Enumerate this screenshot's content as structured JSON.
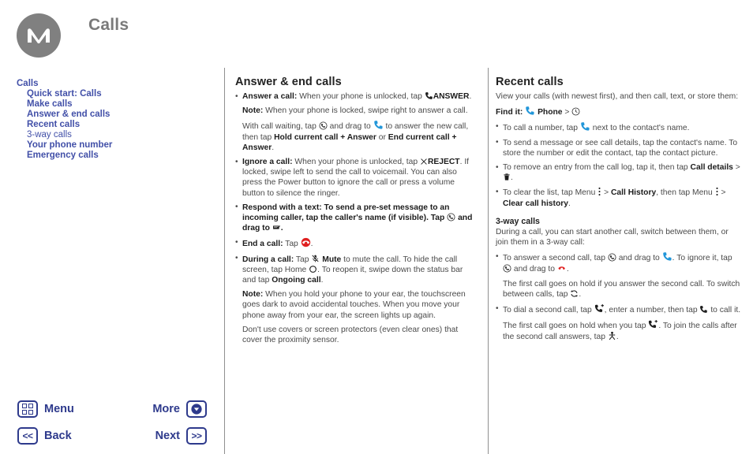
{
  "header": {
    "title": "Calls",
    "logo_icon": "motorola-logo"
  },
  "sidebar": {
    "items": [
      {
        "label": "Calls",
        "level": "root",
        "weight": "bold"
      },
      {
        "label": "Quick start: Calls",
        "level": "sub",
        "weight": "bold"
      },
      {
        "label": "Make calls",
        "level": "sub",
        "weight": "bold"
      },
      {
        "label": "Answer & end calls",
        "level": "sub",
        "weight": "bold"
      },
      {
        "label": "Recent calls",
        "level": "sub",
        "weight": "bold"
      },
      {
        "label": "3-way calls",
        "level": "sub",
        "weight": "light"
      },
      {
        "label": "Your phone number",
        "level": "sub",
        "weight": "bold"
      },
      {
        "label": "Emergency calls",
        "level": "sub",
        "weight": "bold"
      }
    ]
  },
  "middle": {
    "heading": "Answer & end calls",
    "answer_call_label": "Answer a call:",
    "answer_call_text": " When your phone is unlocked, tap",
    "answer_call_action": "ANSWER",
    "answer_call_end": ".",
    "note1_label": "Note:",
    "note1_text": " When your phone is locked, swipe right to answer a call.",
    "call_waiting_pre": "With call waiting, tap",
    "call_waiting_mid": "and drag to",
    "call_waiting_post": "to answer the new call, then tap",
    "call_waiting_opt1": "Hold current call + Answer",
    "call_waiting_or": " or ",
    "call_waiting_opt2": "End current call + Answer",
    "call_waiting_end": ".",
    "ignore_label": "Ignore a call:",
    "ignore_text": " When your phone is unlocked, tap",
    "ignore_action": "REJECT",
    "ignore_rest": ". If locked, swipe left to send the call to voicemail. You can also press the Power button to ignore the call or press a volume button to silence the ringer.",
    "respond_label": "Respond with a text: To send a pre-set message to an incoming caller, tap the caller's name (if visible). Tap",
    "respond_mid": "and drag to",
    "respond_end": ".",
    "end_call_label": "End a call:",
    "end_call_text": " Tap",
    "end_call_end": ".",
    "during_label": "During a call:",
    "during_tap": " Tap",
    "during_mute": "Mute",
    "during_text2": " to mute the call. To hide the call screen, tap Home",
    "during_text3": ". To reopen it, swipe down the status bar and tap",
    "during_ongoing": "Ongoing call",
    "during_end": ".",
    "note2_label": "Note:",
    "note2_text": " When you hold your phone to your ear, the touchscreen goes dark to avoid accidental touches. When you move your phone away from your ear, the screen lights up again.",
    "covers_text": "Don't use covers or screen protectors (even clear ones) that cover the proximity sensor."
  },
  "right": {
    "heading": "Recent calls",
    "intro": "View your calls (with newest first), and then call, text, or store them:",
    "find_it_label": "Find it:",
    "find_it_app": "Phone",
    "find_it_sep": ">",
    "b1_pre": "To call a number, tap",
    "b1_post": "next to the contact's name.",
    "b2": "To send a message or see call details, tap the contact's name. To store the number or edit the contact, tap the contact picture.",
    "b3_pre": "To remove an entry from the call log, tap it, then tap",
    "b3_bold": "Call details",
    "b3_sep": ">",
    "b3_end": ".",
    "b4_pre": "To clear the list, tap Menu",
    "b4_sep1": ">",
    "b4_bold1": "Call History",
    "b4_mid": ", then tap Menu",
    "b4_sep2": ">",
    "b4_bold2": "Clear call history",
    "b4_end": ".",
    "subheading": "3-way calls",
    "sub_intro": "During a call, you can start another call, switch between them, or join them in a 3-way call:",
    "c1_pre": "To answer a second call, tap",
    "c1_mid": "and drag to",
    "c1_mid2": ". To ignore it, tap",
    "c1_mid3": "and drag to",
    "c1_end": ".",
    "c1_para_pre": "The first call goes on hold if you answer the second call. To switch between calls, tap",
    "c1_para_end": ".",
    "c2_pre": "To dial a second call, tap",
    "c2_mid": ", enter a number, then tap",
    "c2_end": "to call it.",
    "c2_para_pre": "The first call goes on hold when you tap",
    "c2_para_mid": ". To join the calls after the second call answers, tap",
    "c2_para_end": "."
  },
  "nav": {
    "menu_label": "Menu",
    "menu_icon": "grid-menu-icon",
    "more_label": "More",
    "more_icon": "chevron-down-circle-icon",
    "back_label": "Back",
    "back_icon": "double-chevron-left-icon",
    "next_label": "Next",
    "next_icon": "double-chevron-right-icon"
  },
  "colors": {
    "accent_blue": "#2e3a8c",
    "toc_blue": "#4250a8",
    "phone_blue": "#2196d9",
    "end_red": "#e02020",
    "logo_gray": "#808080",
    "title_gray": "#7a7a7a"
  }
}
